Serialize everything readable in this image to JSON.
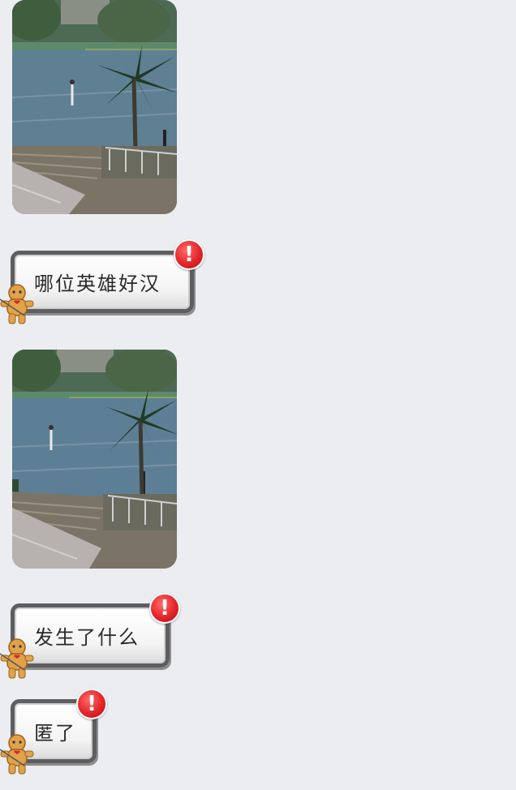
{
  "messages": [
    {
      "type": "image",
      "scene": "rainy-playground-palm-stairs"
    },
    {
      "type": "sticker-text",
      "text": "哪位英雄好汉",
      "badge": "!"
    },
    {
      "type": "image",
      "scene": "rainy-playground-palm-stairs"
    },
    {
      "type": "sticker-text",
      "text": "发生了什么",
      "badge": "!"
    },
    {
      "type": "sticker-text",
      "text": "匿了",
      "badge": "!"
    }
  ],
  "colors": {
    "background": "#ecedf1",
    "bubble_border": "#5e5e60",
    "badge_red": "#e3252a",
    "doll": "#e0a24a"
  }
}
